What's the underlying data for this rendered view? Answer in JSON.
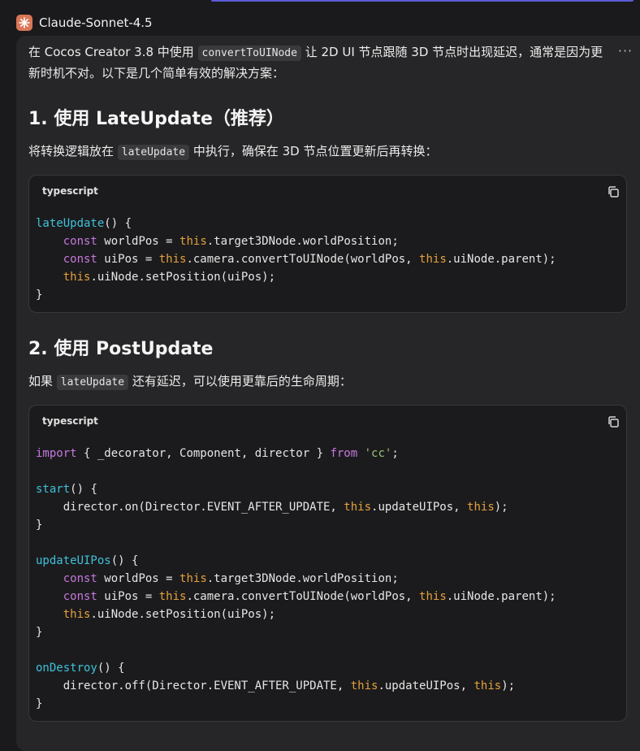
{
  "header": {
    "bot_name": "Claude-Sonnet-4.5",
    "more_label": "···"
  },
  "intro": {
    "p1_a": "在 Cocos Creator 3.8 中使用 ",
    "p1_code": "convertToUINode",
    "p1_b": " 让 2D UI 节点跟随 3D 节点时出现延迟，通常是因为更",
    "p1_c": "新时机不对。以下是几个简单有效的解决方案："
  },
  "section1": {
    "title": "1. 使用 LateUpdate（推荐）",
    "desc_a": "将转换逻辑放在 ",
    "desc_code": "lateUpdate",
    "desc_b": " 中执行，确保在 3D 节点位置更新后再转换：",
    "lang": "typescript"
  },
  "section2": {
    "title": "2. 使用 PostUpdate",
    "desc_a": "如果 ",
    "desc_code": "lateUpdate",
    "desc_b": " 还有延迟，可以使用更靠后的生命周期：",
    "lang": "typescript"
  }
}
